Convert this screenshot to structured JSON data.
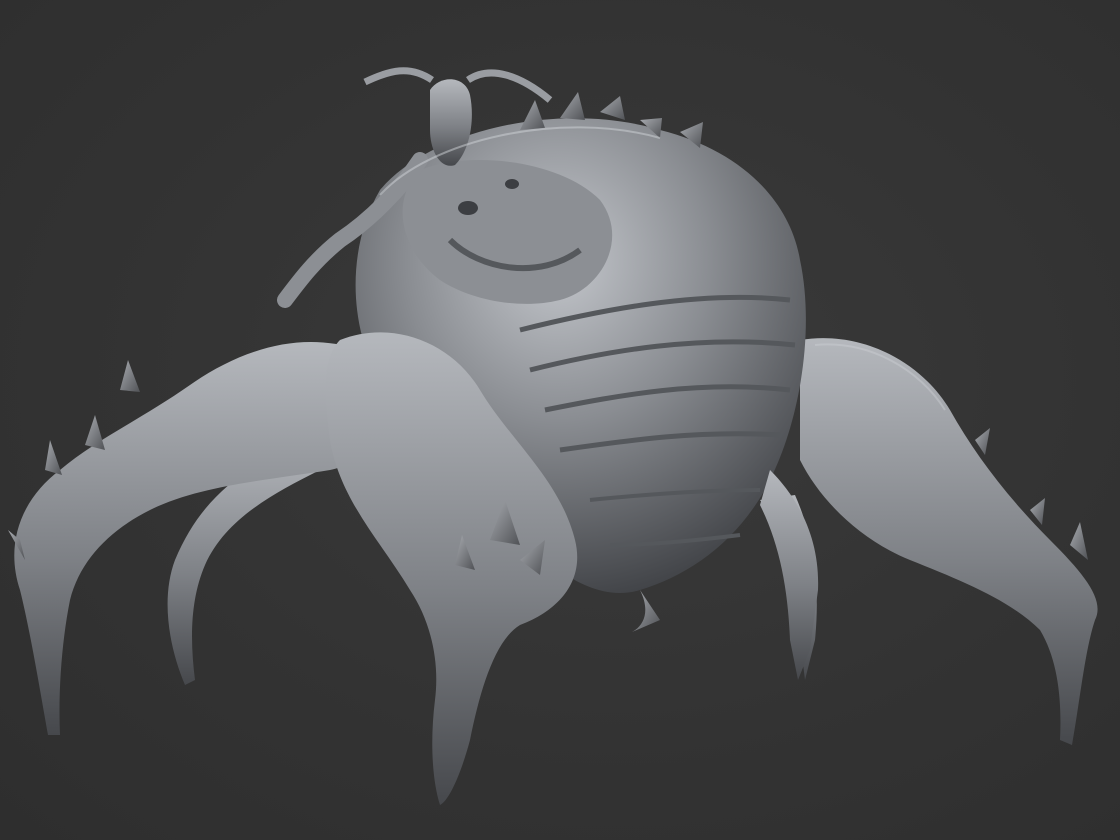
{
  "scene": {
    "background_color": "#333333",
    "material_color": "#8a8d92",
    "highlight_color": "#c4c7cc",
    "shadow_color": "#3c3e42",
    "subject_icon": "spider-creature-sculpt-icon"
  }
}
